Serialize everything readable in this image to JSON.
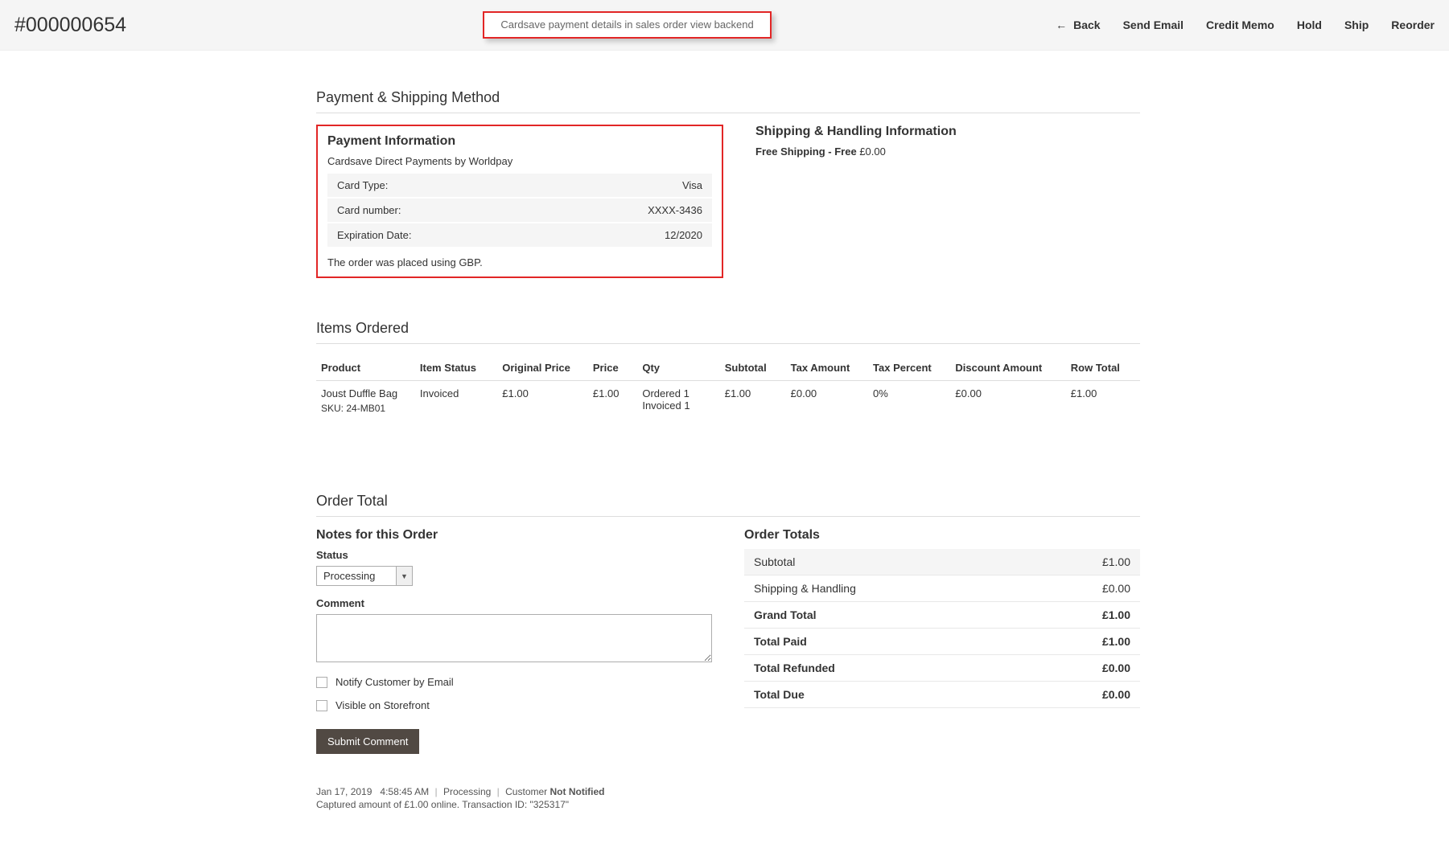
{
  "header": {
    "order_number": "#000000654",
    "callout": "Cardsave payment details in sales order view backend",
    "actions": {
      "back": "Back",
      "send_email": "Send Email",
      "credit_memo": "Credit Memo",
      "hold": "Hold",
      "ship": "Ship",
      "reorder": "Reorder"
    }
  },
  "section_payment_shipping": "Payment & Shipping Method",
  "payment": {
    "title": "Payment Information",
    "method": "Cardsave Direct Payments by Worldpay",
    "rows": {
      "card_type_label": "Card Type:",
      "card_type_value": "Visa",
      "card_number_label": "Card number:",
      "card_number_value": "XXXX-3436",
      "exp_label": "Expiration Date:",
      "exp_value": "12/2020"
    },
    "placed_note": "The order was placed using GBP."
  },
  "shipping": {
    "title": "Shipping & Handling Information",
    "method_label": "Free Shipping - Free",
    "amount": "£0.00"
  },
  "section_items": "Items Ordered",
  "items_headers": {
    "product": "Product",
    "item_status": "Item Status",
    "original_price": "Original Price",
    "price": "Price",
    "qty": "Qty",
    "subtotal": "Subtotal",
    "tax_amount": "Tax Amount",
    "tax_percent": "Tax Percent",
    "discount_amount": "Discount Amount",
    "row_total": "Row Total"
  },
  "items": [
    {
      "name": "Joust Duffle Bag",
      "sku_label": "SKU:",
      "sku": "24-MB01",
      "status": "Invoiced",
      "original_price": "£1.00",
      "price": "£1.00",
      "qty_ordered": "Ordered 1",
      "qty_invoiced": "Invoiced 1",
      "subtotal": "£1.00",
      "tax_amount": "£0.00",
      "tax_percent": "0%",
      "discount": "£0.00",
      "row_total": "£1.00"
    }
  ],
  "section_order_total": "Order Total",
  "notes": {
    "title": "Notes for this Order",
    "status_label": "Status",
    "status_value": "Processing",
    "comment_label": "Comment",
    "notify_label": "Notify Customer by Email",
    "visible_label": "Visible on Storefront",
    "submit": "Submit Comment"
  },
  "totals": {
    "title": "Order Totals",
    "subtotal_label": "Subtotal",
    "subtotal_value": "£1.00",
    "shipping_label": "Shipping & Handling",
    "shipping_value": "£0.00",
    "grand_label": "Grand Total",
    "grand_value": "£1.00",
    "paid_label": "Total Paid",
    "paid_value": "£1.00",
    "refunded_label": "Total Refunded",
    "refunded_value": "£0.00",
    "due_label": "Total Due",
    "due_value": "£0.00"
  },
  "history": {
    "date": "Jan 17, 2019",
    "time": "4:58:45 AM",
    "status": "Processing",
    "customer_label": "Customer",
    "notified": "Not Notified",
    "capture": "Captured amount of £1.00 online. Transaction ID: \"325317\""
  }
}
